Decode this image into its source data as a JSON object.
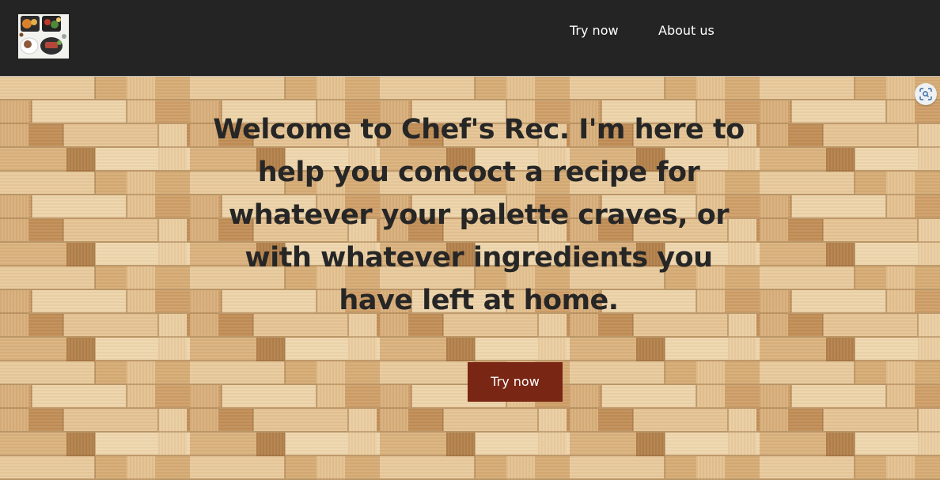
{
  "header": {
    "logo_icon": "food-platter-logo-icon",
    "nav": [
      {
        "label": "Try now"
      },
      {
        "label": "About us"
      }
    ],
    "background_color": "#242424"
  },
  "hero": {
    "headline": "Welcome to Chef's Rec. I'm here to help you concoct a recipe for whatever your palette craves, or with whatever ingredients you have left at home.",
    "cta_label": "Try now",
    "cta_color": "#7a2614",
    "background": "woven-bamboo-texture",
    "overlay_icon": "visual-search-icon"
  }
}
